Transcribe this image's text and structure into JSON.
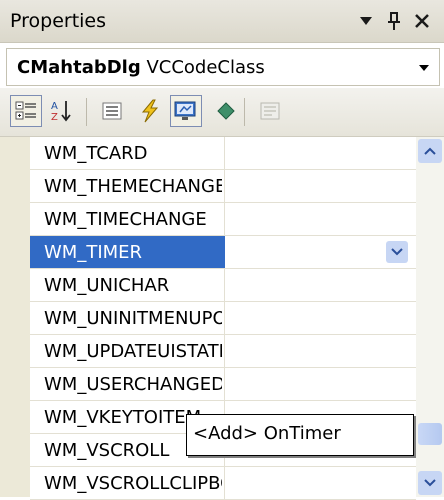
{
  "panel": {
    "title": "Properties",
    "controls": {
      "dropdown": "▾",
      "pin": "ᵖ",
      "close": "×"
    }
  },
  "object_selector": {
    "bold_text": "CMahtabDlg",
    "type_text": "VCCodeClass"
  },
  "toolbar": {
    "tools": [
      {
        "icon": "categorized-icon",
        "pressed": true
      },
      {
        "icon": "alphabetical-sort-icon",
        "pressed": false
      },
      {
        "icon": "properties-list-icon",
        "pressed": false
      },
      {
        "icon": "events-lightning-icon",
        "pressed": false
      },
      {
        "icon": "messages-icon",
        "pressed": true
      },
      {
        "icon": "overrides-icon",
        "pressed": false
      },
      {
        "icon": "property-pages-icon",
        "pressed": false
      }
    ]
  },
  "rows": [
    {
      "name": "WM_TCARD"
    },
    {
      "name": "WM_THEMECHANGED"
    },
    {
      "name": "WM_TIMECHANGE"
    },
    {
      "name": "WM_TIMER",
      "selected": true
    },
    {
      "name": "WM_UNICHAR"
    },
    {
      "name": "WM_UNINITMENUPOPUP"
    },
    {
      "name": "WM_UPDATEUISTATE"
    },
    {
      "name": "WM_USERCHANGED"
    },
    {
      "name": "WM_VKEYTOITEM"
    },
    {
      "name": "WM_VSCROLL"
    },
    {
      "name": "WM_VSCROLLCLIPBOARD"
    }
  ],
  "dropdown_popup": {
    "option": "<Add> OnTimer"
  },
  "colors": {
    "selection": "#316ac5",
    "scroll_accent": "#c7d6f4"
  }
}
